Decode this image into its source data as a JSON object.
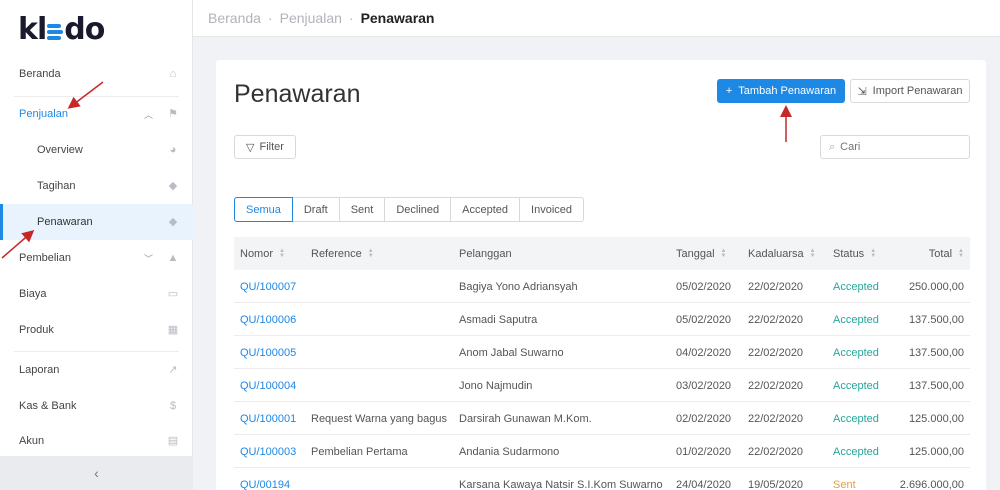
{
  "app": {
    "logo_left": "kl",
    "logo_right": "do"
  },
  "sidebar": {
    "items": [
      {
        "label": "Beranda",
        "icon": "home-icon",
        "glyph": "⌂"
      },
      {
        "label": "Penjualan",
        "icon": "basket-icon",
        "glyph": "⚑",
        "expanded": true
      },
      {
        "label": "Overview",
        "icon": "pie-chart-icon",
        "glyph": "◕"
      },
      {
        "label": "Tagihan",
        "icon": "tags-icon",
        "glyph": "◆"
      },
      {
        "label": "Penawaran",
        "icon": "tag-icon",
        "glyph": "◆",
        "active": true
      },
      {
        "label": "Pembelian",
        "icon": "shopping-bag-icon",
        "glyph": "▲"
      },
      {
        "label": "Biaya",
        "icon": "credit-card-icon",
        "glyph": "▭"
      },
      {
        "label": "Produk",
        "icon": "cubes-icon",
        "glyph": "▦"
      },
      {
        "label": "Laporan",
        "icon": "line-chart-icon",
        "glyph": "↗"
      },
      {
        "label": "Kas & Bank",
        "icon": "dollar-icon",
        "glyph": "$"
      },
      {
        "label": "Akun",
        "icon": "list-icon",
        "glyph": "▤"
      }
    ],
    "collapse_glyph": "‹"
  },
  "breadcrumb": {
    "items": [
      "Beranda",
      "Penjualan"
    ],
    "current": "Penawaran",
    "separator": "·"
  },
  "page": {
    "title": "Penawaran",
    "add_button": "Tambah Penawaran",
    "import_button": "Import Penawaran",
    "filter_button": "Filter",
    "search_placeholder": "Cari"
  },
  "tabs": [
    "Semua",
    "Draft",
    "Sent",
    "Declined",
    "Accepted",
    "Invoiced"
  ],
  "table": {
    "columns": [
      "Nomor",
      "Reference",
      "Pelanggan",
      "Tanggal",
      "Kadaluarsa",
      "Status",
      "Total"
    ],
    "rows": [
      {
        "nomor": "QU/100007",
        "reference": "",
        "pelanggan": "Bagiya Yono Adriansyah",
        "tanggal": "05/02/2020",
        "kadaluarsa": "22/02/2020",
        "status": "Accepted",
        "total": "250.000,00"
      },
      {
        "nomor": "QU/100006",
        "reference": "",
        "pelanggan": "Asmadi Saputra",
        "tanggal": "05/02/2020",
        "kadaluarsa": "22/02/2020",
        "status": "Accepted",
        "total": "137.500,00"
      },
      {
        "nomor": "QU/100005",
        "reference": "",
        "pelanggan": "Anom Jabal Suwarno",
        "tanggal": "04/02/2020",
        "kadaluarsa": "22/02/2020",
        "status": "Accepted",
        "total": "137.500,00"
      },
      {
        "nomor": "QU/100004",
        "reference": "",
        "pelanggan": "Jono Najmudin",
        "tanggal": "03/02/2020",
        "kadaluarsa": "22/02/2020",
        "status": "Accepted",
        "total": "137.500,00"
      },
      {
        "nomor": "QU/100001",
        "reference": "Request Warna yang bagus",
        "pelanggan": "Darsirah Gunawan M.Kom.",
        "tanggal": "02/02/2020",
        "kadaluarsa": "22/02/2020",
        "status": "Accepted",
        "total": "125.000,00"
      },
      {
        "nomor": "QU/100003",
        "reference": "Pembelian Pertama",
        "pelanggan": "Andania Sudarmono",
        "tanggal": "01/02/2020",
        "kadaluarsa": "22/02/2020",
        "status": "Accepted",
        "total": "125.000,00"
      },
      {
        "nomor": "QU/00194",
        "reference": "",
        "pelanggan": "Karsana Kawaya Natsir S.I.Kom Suwarno",
        "tanggal": "24/04/2020",
        "kadaluarsa": "19/05/2020",
        "status": "Sent",
        "total": "2.696.000,00"
      }
    ]
  },
  "colors": {
    "accent": "#1e88e5",
    "accepted": "#26a69a",
    "sent": "#e0a040",
    "annotation": "#c62828"
  }
}
